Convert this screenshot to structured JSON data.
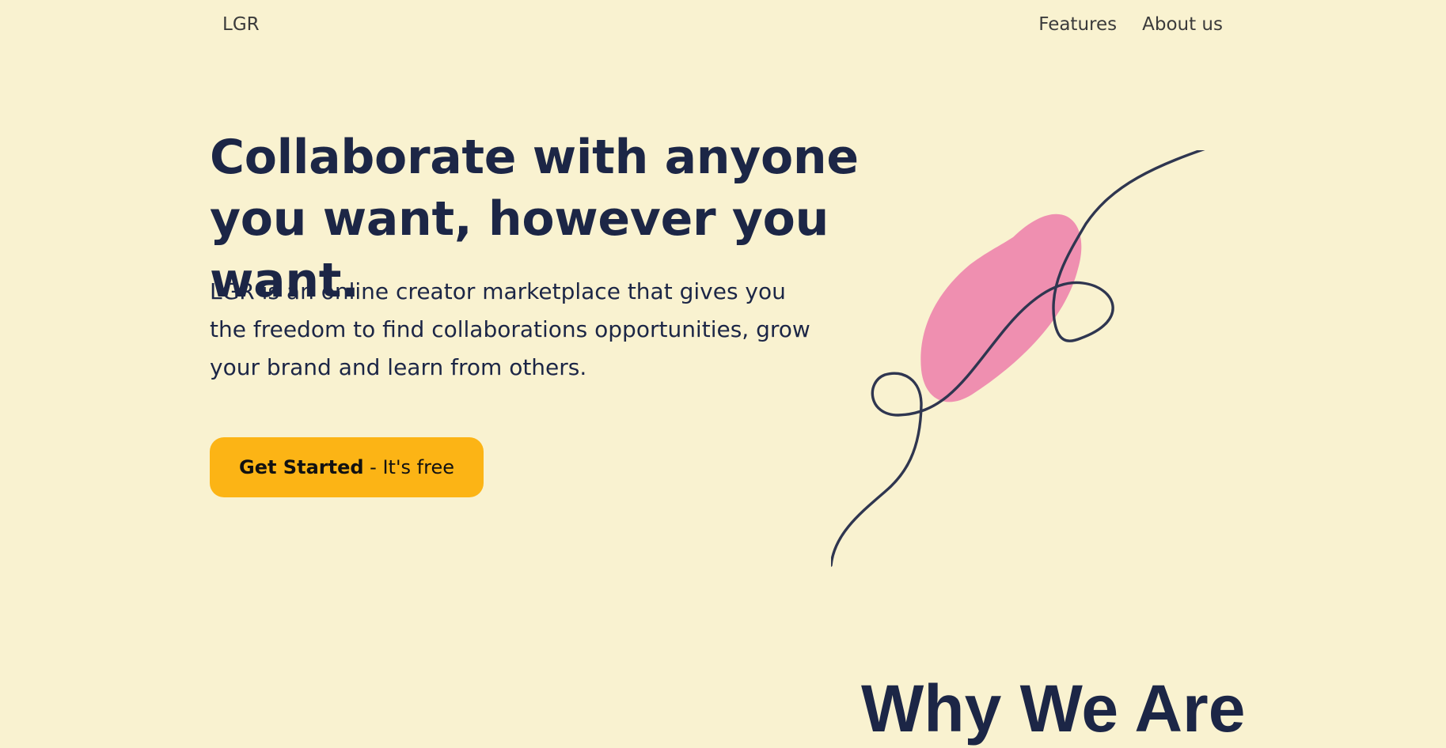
{
  "nav": {
    "logo": "LGR",
    "links": [
      "Features",
      "About us"
    ]
  },
  "hero": {
    "title": "Collaborate with anyone you want, however you want.",
    "description": "LGR is an online creator marketplace that gives you the freedom to find collaborations opportunities, grow your brand and learn from others.",
    "cta": {
      "strong": "Get Started",
      "rest": " - It's free"
    },
    "illustration": {
      "blob_color": "#ef8fb0",
      "stroke_color": "#2f3650"
    }
  },
  "section": {
    "heading": "Why We Are"
  },
  "colors": {
    "background": "#f9f2d0",
    "text": "#1c2646",
    "accent": "#fcb415"
  }
}
